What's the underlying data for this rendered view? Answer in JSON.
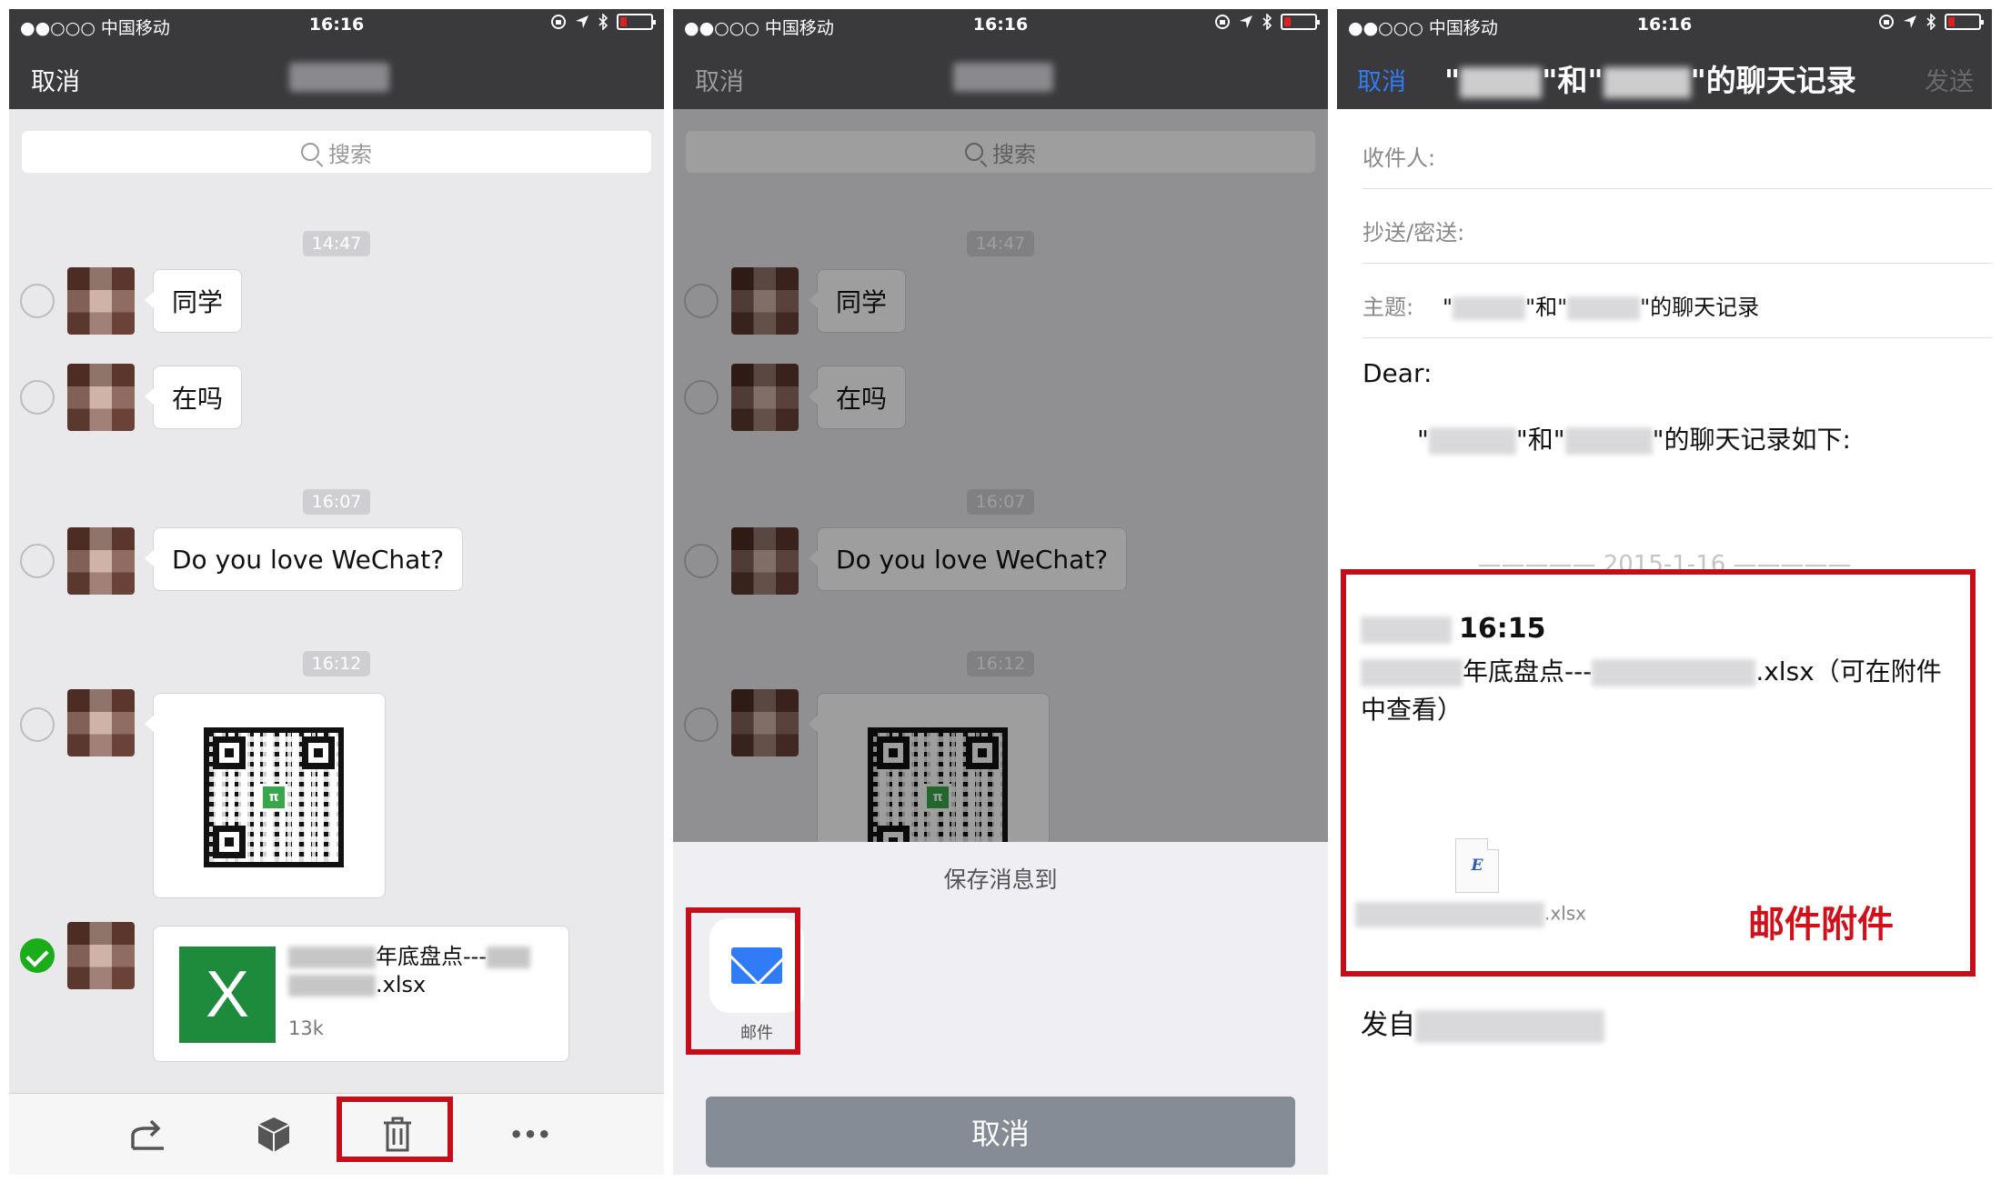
{
  "status": {
    "carrier": "●●○○○ 中国移动",
    "time": "16:16"
  },
  "panel1": {
    "cancel_label": "取消",
    "search_placeholder": "搜索",
    "timestamps": [
      "14:47",
      "16:07",
      "16:12"
    ],
    "messages": [
      "同学",
      "在吗",
      "Do you love WeChat?"
    ],
    "qr_logo": "π",
    "file": {
      "name_part": "年底盘点---",
      "ext": ".xlsx",
      "size": "13k",
      "icon_letter": "X"
    },
    "toolbar_more": "•••"
  },
  "panel2": {
    "cancel_label": "取消",
    "search_placeholder": "搜索",
    "timestamps": [
      "14:47",
      "16:07",
      "16:12"
    ],
    "messages": [
      "同学",
      "在吗",
      "Do you love WeChat?"
    ],
    "sheet_title": "保存消息到",
    "mail_label": "邮件",
    "sheet_cancel": "取消"
  },
  "panel3": {
    "cancel_label": "取消",
    "send_label": "发送",
    "title_parts": [
      "\"",
      "\"和\"",
      "\"的聊天记录"
    ],
    "to_label": "收件人:",
    "cc_label": "抄送/密送:",
    "subject_label": "主题:",
    "subject_parts": [
      "\"",
      "\"和\"",
      "\"的聊天记录"
    ],
    "dear": "Dear:",
    "intro_parts": [
      "\"",
      "\"和\"",
      "\"的聊天记录如下:"
    ],
    "dateline": "————— 2015-1-16 —————",
    "msg_time": "16:15",
    "msg_text_1": "年底盘点---",
    "msg_text_2": ".xlsx（可在附件",
    "msg_text_3": "中查看）",
    "attach_icon": "E",
    "attach_name": ".xlsx",
    "attach_label": "邮件附件",
    "sent_from": "发自"
  },
  "colors": {
    "nav_bg": "#3a3a3d",
    "chat_bg": "#e9e9ec",
    "wechat_green": "#1aad19",
    "highlight_red": "#c40f1a",
    "mail_blue": "#2f7cf6"
  }
}
